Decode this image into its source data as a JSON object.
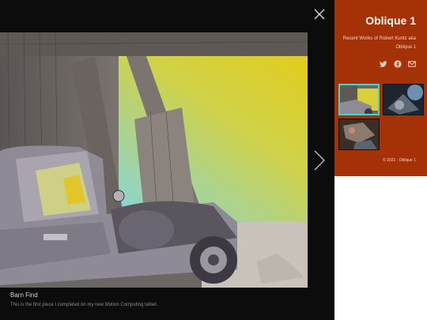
{
  "site": {
    "title": "Oblique 1",
    "tagline": "Recent Works of Robert Kuntz aka Oblique 1",
    "copyright": "© 2021 - Oblique 1"
  },
  "social": [
    "twitter-icon",
    "facebook-icon",
    "email-icon"
  ],
  "viewer": {
    "caption_title": "Barn Find",
    "caption_description": "This is the first piece I completed on my new Motion Computing tablet."
  },
  "colors": {
    "accent": "#a53206",
    "viewer_bg": "#0c0c0c",
    "thumb_active": "#4fd0c8"
  }
}
